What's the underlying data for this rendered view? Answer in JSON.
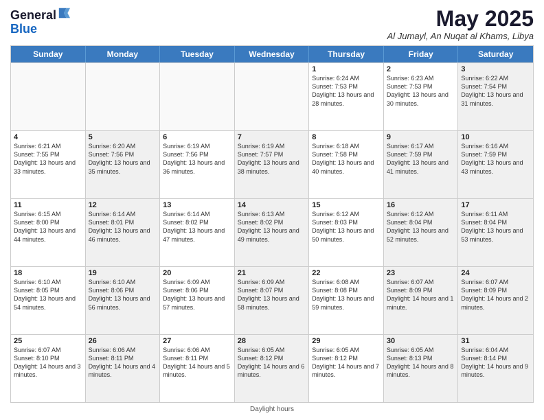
{
  "header": {
    "logo_line1": "General",
    "logo_line2": "Blue",
    "month_title": "May 2025",
    "location": "Al Jumayl, An Nuqat al Khams, Libya"
  },
  "days_of_week": [
    "Sunday",
    "Monday",
    "Tuesday",
    "Wednesday",
    "Thursday",
    "Friday",
    "Saturday"
  ],
  "footer": {
    "daylight_note": "Daylight hours"
  },
  "weeks": [
    {
      "cells": [
        {
          "day": "",
          "empty": true
        },
        {
          "day": "",
          "empty": true
        },
        {
          "day": "",
          "empty": true
        },
        {
          "day": "",
          "empty": true
        },
        {
          "day": "1",
          "sunrise": "Sunrise: 6:24 AM",
          "sunset": "Sunset: 7:53 PM",
          "daylight": "Daylight: 13 hours and 28 minutes."
        },
        {
          "day": "2",
          "sunrise": "Sunrise: 6:23 AM",
          "sunset": "Sunset: 7:53 PM",
          "daylight": "Daylight: 13 hours and 30 minutes."
        },
        {
          "day": "3",
          "sunrise": "Sunrise: 6:22 AM",
          "sunset": "Sunset: 7:54 PM",
          "daylight": "Daylight: 13 hours and 31 minutes.",
          "shaded": true
        }
      ]
    },
    {
      "cells": [
        {
          "day": "4",
          "sunrise": "Sunrise: 6:21 AM",
          "sunset": "Sunset: 7:55 PM",
          "daylight": "Daylight: 13 hours and 33 minutes."
        },
        {
          "day": "5",
          "sunrise": "Sunrise: 6:20 AM",
          "sunset": "Sunset: 7:56 PM",
          "daylight": "Daylight: 13 hours and 35 minutes.",
          "shaded": true
        },
        {
          "day": "6",
          "sunrise": "Sunrise: 6:19 AM",
          "sunset": "Sunset: 7:56 PM",
          "daylight": "Daylight: 13 hours and 36 minutes."
        },
        {
          "day": "7",
          "sunrise": "Sunrise: 6:19 AM",
          "sunset": "Sunset: 7:57 PM",
          "daylight": "Daylight: 13 hours and 38 minutes.",
          "shaded": true
        },
        {
          "day": "8",
          "sunrise": "Sunrise: 6:18 AM",
          "sunset": "Sunset: 7:58 PM",
          "daylight": "Daylight: 13 hours and 40 minutes."
        },
        {
          "day": "9",
          "sunrise": "Sunrise: 6:17 AM",
          "sunset": "Sunset: 7:59 PM",
          "daylight": "Daylight: 13 hours and 41 minutes.",
          "shaded": true
        },
        {
          "day": "10",
          "sunrise": "Sunrise: 6:16 AM",
          "sunset": "Sunset: 7:59 PM",
          "daylight": "Daylight: 13 hours and 43 minutes.",
          "shaded": true
        }
      ]
    },
    {
      "cells": [
        {
          "day": "11",
          "sunrise": "Sunrise: 6:15 AM",
          "sunset": "Sunset: 8:00 PM",
          "daylight": "Daylight: 13 hours and 44 minutes."
        },
        {
          "day": "12",
          "sunrise": "Sunrise: 6:14 AM",
          "sunset": "Sunset: 8:01 PM",
          "daylight": "Daylight: 13 hours and 46 minutes.",
          "shaded": true
        },
        {
          "day": "13",
          "sunrise": "Sunrise: 6:14 AM",
          "sunset": "Sunset: 8:02 PM",
          "daylight": "Daylight: 13 hours and 47 minutes."
        },
        {
          "day": "14",
          "sunrise": "Sunrise: 6:13 AM",
          "sunset": "Sunset: 8:02 PM",
          "daylight": "Daylight: 13 hours and 49 minutes.",
          "shaded": true
        },
        {
          "day": "15",
          "sunrise": "Sunrise: 6:12 AM",
          "sunset": "Sunset: 8:03 PM",
          "daylight": "Daylight: 13 hours and 50 minutes."
        },
        {
          "day": "16",
          "sunrise": "Sunrise: 6:12 AM",
          "sunset": "Sunset: 8:04 PM",
          "daylight": "Daylight: 13 hours and 52 minutes.",
          "shaded": true
        },
        {
          "day": "17",
          "sunrise": "Sunrise: 6:11 AM",
          "sunset": "Sunset: 8:04 PM",
          "daylight": "Daylight: 13 hours and 53 minutes.",
          "shaded": true
        }
      ]
    },
    {
      "cells": [
        {
          "day": "18",
          "sunrise": "Sunrise: 6:10 AM",
          "sunset": "Sunset: 8:05 PM",
          "daylight": "Daylight: 13 hours and 54 minutes."
        },
        {
          "day": "19",
          "sunrise": "Sunrise: 6:10 AM",
          "sunset": "Sunset: 8:06 PM",
          "daylight": "Daylight: 13 hours and 56 minutes.",
          "shaded": true
        },
        {
          "day": "20",
          "sunrise": "Sunrise: 6:09 AM",
          "sunset": "Sunset: 8:06 PM",
          "daylight": "Daylight: 13 hours and 57 minutes."
        },
        {
          "day": "21",
          "sunrise": "Sunrise: 6:09 AM",
          "sunset": "Sunset: 8:07 PM",
          "daylight": "Daylight: 13 hours and 58 minutes.",
          "shaded": true
        },
        {
          "day": "22",
          "sunrise": "Sunrise: 6:08 AM",
          "sunset": "Sunset: 8:08 PM",
          "daylight": "Daylight: 13 hours and 59 minutes."
        },
        {
          "day": "23",
          "sunrise": "Sunrise: 6:07 AM",
          "sunset": "Sunset: 8:09 PM",
          "daylight": "Daylight: 14 hours and 1 minute.",
          "shaded": true
        },
        {
          "day": "24",
          "sunrise": "Sunrise: 6:07 AM",
          "sunset": "Sunset: 8:09 PM",
          "daylight": "Daylight: 14 hours and 2 minutes.",
          "shaded": true
        }
      ]
    },
    {
      "cells": [
        {
          "day": "25",
          "sunrise": "Sunrise: 6:07 AM",
          "sunset": "Sunset: 8:10 PM",
          "daylight": "Daylight: 14 hours and 3 minutes."
        },
        {
          "day": "26",
          "sunrise": "Sunrise: 6:06 AM",
          "sunset": "Sunset: 8:11 PM",
          "daylight": "Daylight: 14 hours and 4 minutes.",
          "shaded": true
        },
        {
          "day": "27",
          "sunrise": "Sunrise: 6:06 AM",
          "sunset": "Sunset: 8:11 PM",
          "daylight": "Daylight: 14 hours and 5 minutes."
        },
        {
          "day": "28",
          "sunrise": "Sunrise: 6:05 AM",
          "sunset": "Sunset: 8:12 PM",
          "daylight": "Daylight: 14 hours and 6 minutes.",
          "shaded": true
        },
        {
          "day": "29",
          "sunrise": "Sunrise: 6:05 AM",
          "sunset": "Sunset: 8:12 PM",
          "daylight": "Daylight: 14 hours and 7 minutes."
        },
        {
          "day": "30",
          "sunrise": "Sunrise: 6:05 AM",
          "sunset": "Sunset: 8:13 PM",
          "daylight": "Daylight: 14 hours and 8 minutes.",
          "shaded": true
        },
        {
          "day": "31",
          "sunrise": "Sunrise: 6:04 AM",
          "sunset": "Sunset: 8:14 PM",
          "daylight": "Daylight: 14 hours and 9 minutes.",
          "shaded": true
        }
      ]
    }
  ]
}
